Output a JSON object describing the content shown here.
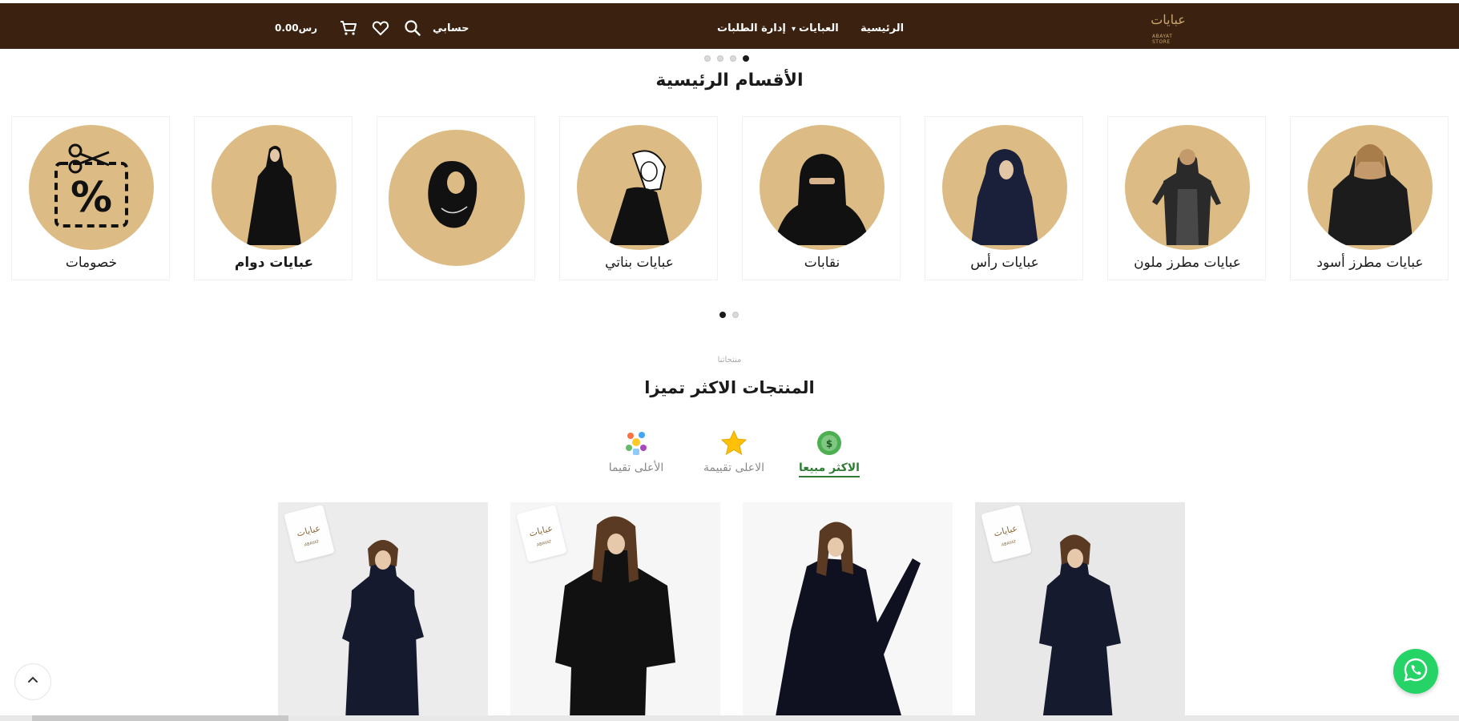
{
  "header": {
    "logo_text": "عبايات",
    "logo_sub": "ABAYAT STORE",
    "nav": {
      "home": "الرئيسية",
      "abayas": "العبايات",
      "manage_orders": "إدارة الطلبات"
    },
    "account": "حسابي",
    "cart_total": "رس0.00",
    "icons": {
      "search": "search-icon",
      "wishlist": "heart-icon",
      "cart": "cart-icon"
    },
    "colors": {
      "bar": "#3b2210",
      "gold": "#c9a46c"
    }
  },
  "categories": {
    "title": "الأقسام الرئيسية",
    "items": [
      {
        "label": "عبايات مطرز أسود"
      },
      {
        "label": "عبايات مطرز ملون"
      },
      {
        "label": "عبايات رأس"
      },
      {
        "label": "نقابات"
      },
      {
        "label": "عبايات بناتي"
      },
      {
        "label": ""
      },
      {
        "label": "عبايات دوام"
      },
      {
        "label": "خصومات"
      }
    ],
    "circle_color": "#dcbb84"
  },
  "featured": {
    "kicker": "منتجاتنا",
    "title": "المنتجات الاكثر تميزا",
    "tabs": [
      {
        "label": "الاكثر مبيعا",
        "icon": "bestseller-badge-icon",
        "active": true
      },
      {
        "label": "الاعلى تقييمة",
        "icon": "star-icon",
        "active": false
      },
      {
        "label": "الأعلى تقيما",
        "icon": "confetti-icon",
        "active": false
      }
    ]
  },
  "products": [
    {
      "stamp": "عبايات",
      "stamp_sub": "ABAYAT"
    },
    {
      "stamp": "عبايات",
      "stamp_sub": "ABAYAT"
    },
    {
      "stamp": "",
      "stamp_sub": ""
    },
    {
      "stamp": "عبايات",
      "stamp_sub": "ABAYAT"
    }
  ],
  "widgets": {
    "back_to_top": "chevron-up-icon",
    "whatsapp": "whatsapp-icon"
  }
}
